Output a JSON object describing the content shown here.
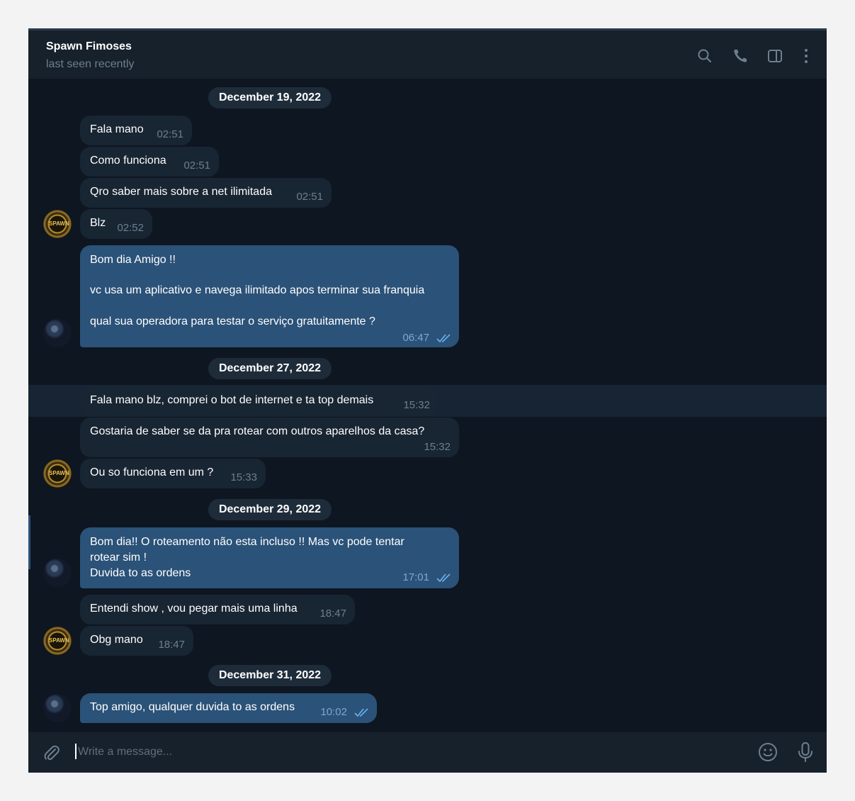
{
  "header": {
    "chat_name": "Spawn Fimoses",
    "status": "last seen recently"
  },
  "dates": [
    "December 19, 2022",
    "December 27, 2022",
    "December 29, 2022",
    "December 31, 2022"
  ],
  "messages": [
    {
      "text": "Fala mano",
      "time": "02:51"
    },
    {
      "text": "Como funciona",
      "time": "02:51"
    },
    {
      "text": "Qro saber mais sobre a net ilimitada",
      "time": "02:51"
    },
    {
      "text": "Blz",
      "time": "02:52"
    },
    {
      "lines": [
        "Bom dia Amigo !!",
        "vc usa um aplicativo e navega ilimitado apos terminar sua franquia",
        "qual sua operadora para testar o serviço gratuitamente ?"
      ],
      "time": "06:47"
    },
    {
      "text": "Fala mano blz, comprei o bot de internet e ta top demais",
      "time": "15:32"
    },
    {
      "text": "Gostaria de saber se da pra rotear com outros aparelhos da casa?",
      "time": "15:32"
    },
    {
      "text": "Ou so funciona em um ?",
      "time": "15:33"
    },
    {
      "lines": [
        "Bom dia!! O roteamento não esta incluso !! Mas vc pode tentar",
        "rotear sim !",
        "Duvida to as ordens"
      ],
      "time": "17:01"
    },
    {
      "text": "Entendi show , vou pegar mais uma linha",
      "time": "18:47"
    },
    {
      "text": "Obg mano",
      "time": "18:47"
    },
    {
      "text": "Top amigo, qualquer duvida to as ordens",
      "time": "10:02"
    }
  ],
  "composer": {
    "placeholder": "Write a message..."
  },
  "colors": {
    "background": "#0e1621",
    "header": "#17212b",
    "incoming_bubble": "#182533",
    "outgoing_bubble": "#2b5278",
    "accent": "#6ab2f2"
  },
  "icons": [
    "search-icon",
    "phone-icon",
    "sidebar-toggle-icon",
    "more-vertical-icon",
    "chevron-down-icon",
    "paperclip-icon",
    "emoji-icon",
    "microphone-icon",
    "double-check-icon"
  ]
}
